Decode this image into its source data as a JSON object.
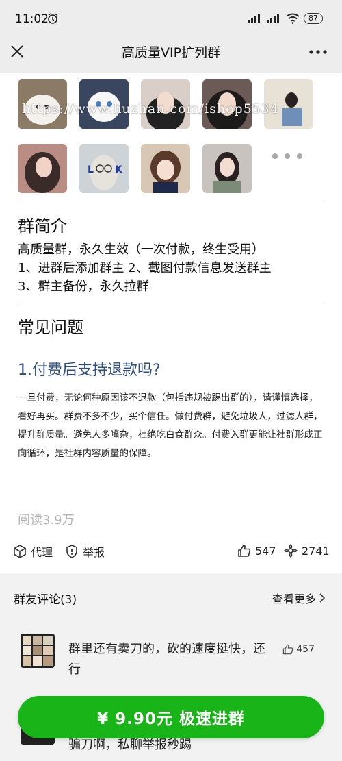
{
  "status": {
    "time": "11:02",
    "battery": "87"
  },
  "nav": {
    "title": "高质量VIP扩列群"
  },
  "watermark": "https://www.huzhan.com/ishop5534",
  "intro": {
    "title": "群简介",
    "lines": [
      "高质量群，永久生效（一次付款，终生受用）",
      "1、进群后添加群主 2、截图付款信息发送群主",
      "3、群主备份，永久拉群"
    ]
  },
  "faq": {
    "title": "常见问题",
    "question": "1.付费后支持退款吗?",
    "answer": "一旦付费，无论何种原因该不退款（包括违规被踢出群的），请谨慎选择，看好再买。群费不多不少，买个信任。做付费群，避免垃圾人，过滤人群，提升群质量。避免人多嘴杂，杜绝吃白食群众。付费入群更能让社群形成正向循环，是社群内容质量的保障。"
  },
  "stats": {
    "reads": "阅读3.9万",
    "agent_label": "代理",
    "report_label": "举报",
    "likes": "547",
    "shares": "2741"
  },
  "comments": {
    "header": "群友评论(3)",
    "see_more": "查看更多",
    "items": [
      {
        "text": "群里还有卖刀的，砍的速度挺快，还行",
        "likes": "457"
      },
      {
        "text": "骗刀啊，私聊举报秒踢"
      }
    ]
  },
  "join_button": "¥ 9.90元 极速进群",
  "colors": {
    "accent_green": "#18b418",
    "faq_blue": "#2d4d84",
    "nav_bg": "#ededed"
  }
}
